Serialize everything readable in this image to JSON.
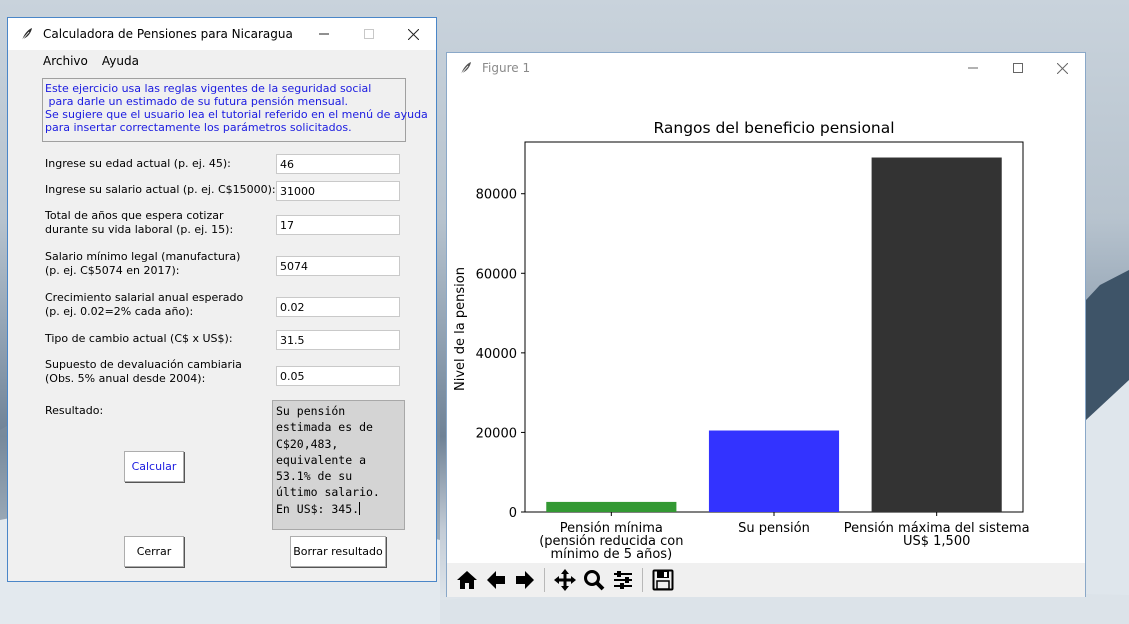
{
  "calc_window": {
    "title": "Calculadora de Pensiones para Nicaragua",
    "menu": [
      "Archivo",
      "Ayuda"
    ],
    "intro_lines": [
      "Este ejercicio usa las reglas vigentes de la seguridad social",
      " para darle un estimado de su futura pensión mensual.",
      "Se sugiere que el usuario lea el tutorial referido en el menú de ayuda",
      "para insertar correctamente los parámetros solicitados."
    ],
    "fields": [
      {
        "label_lines": [
          "Ingrese su edad actual (p. ej. 45):"
        ],
        "value": "46"
      },
      {
        "label_lines": [
          "Ingrese su salario actual (p. ej. C$15000):"
        ],
        "value": "31000"
      },
      {
        "label_lines": [
          "Total de años que espera cotizar",
          "durante su vida laboral (p. ej. 15):"
        ],
        "value": "17"
      },
      {
        "label_lines": [
          "Salario mínimo legal (manufactura)",
          "(p. ej. C$5074 en 2017):"
        ],
        "value": "5074"
      },
      {
        "label_lines": [
          "Crecimiento salarial anual esperado",
          "(p. ej. 0.02=2% cada año):"
        ],
        "value": "0.02"
      },
      {
        "label_lines": [
          "Tipo de cambio actual (C$ x US$):"
        ],
        "value": "31.5"
      },
      {
        "label_lines": [
          "Supuesto de devaluación cambiaria",
          "(Obs. 5% anual desde 2004):"
        ],
        "value": "0.05"
      }
    ],
    "result_label": "Resultado:",
    "result_text": "Su pensión\nestimada es de\nC$20,483,\nequivalente a\n53.1% de su\núltimo salario.\nEn US$: 345.",
    "buttons": {
      "calcular": "Calcular",
      "cerrar": "Cerrar",
      "borrar": "Borrar resultado"
    }
  },
  "figure_window": {
    "title": "Figure 1",
    "toolbar_icons": [
      "home-icon",
      "back-arrow-icon",
      "forward-arrow-icon",
      "pan-icon",
      "zoom-icon",
      "configure-subplots-icon",
      "save-icon"
    ]
  },
  "chart_data": {
    "type": "bar",
    "title": "Rangos del beneficio pensional",
    "xlabel": "",
    "ylabel": "Nivel de la pension",
    "categories": [
      "Pensión mínima\n(pensión reducida con\nmínimo de 5 años)",
      "Su pensión",
      "Pensión máxima del sistema\nUS$ 1,500"
    ],
    "values": [
      2537,
      20483,
      89100
    ],
    "colors": [
      "#339933",
      "#3333ff",
      "#333333"
    ],
    "ylim": [
      0,
      93000
    ],
    "yticks": [
      0,
      20000,
      40000,
      60000,
      80000
    ],
    "ytick_labels": [
      "0",
      "20000",
      "40000",
      "60000",
      "80000"
    ],
    "grid": false,
    "legend": "none"
  }
}
